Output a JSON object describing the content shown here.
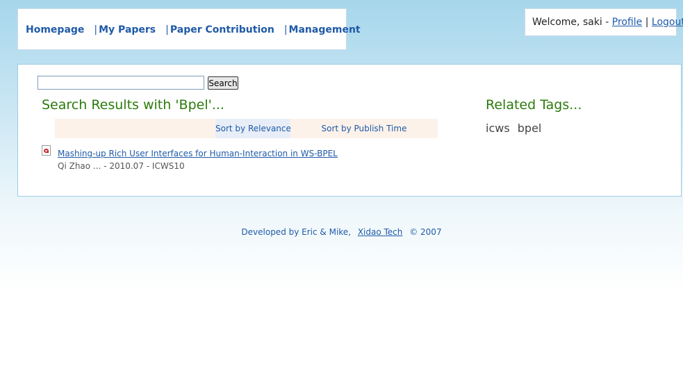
{
  "nav": {
    "items": [
      {
        "label": "Homepage"
      },
      {
        "label": "My Papers"
      },
      {
        "label": "Paper Contribution"
      },
      {
        "label": "Management"
      }
    ],
    "separator": "|"
  },
  "user": {
    "welcome": "Welcome, saki - ",
    "profile_label": "Profile",
    "divider": " | ",
    "logout_label": "Logout"
  },
  "search": {
    "value": "",
    "button_label": "Search"
  },
  "results": {
    "title": "Search Results with 'Bpel'...",
    "sort": {
      "relevance_label": "Sort by Relevance",
      "publish_time_label": "Sort by Publish Time"
    },
    "items": [
      {
        "icon": "pdf-icon",
        "title": "Mashing-up Rich User Interfaces for Human-Interaction in WS-BPEL",
        "meta": "Qi Zhao ... - 2010.07 - ICWS10"
      }
    ]
  },
  "tags": {
    "title": "Related Tags...",
    "items": [
      "icws",
      "bpel"
    ]
  },
  "footer": {
    "prefix": "Developed by Eric & Mike,",
    "link_label": "Xidao Tech",
    "suffix": "© 2007"
  },
  "colors": {
    "link": "#1f5aa8",
    "heading_green": "#2b7a0b",
    "sort_bar_bg": "#fdf2ea",
    "sort_active_bg": "#e8eef8"
  }
}
